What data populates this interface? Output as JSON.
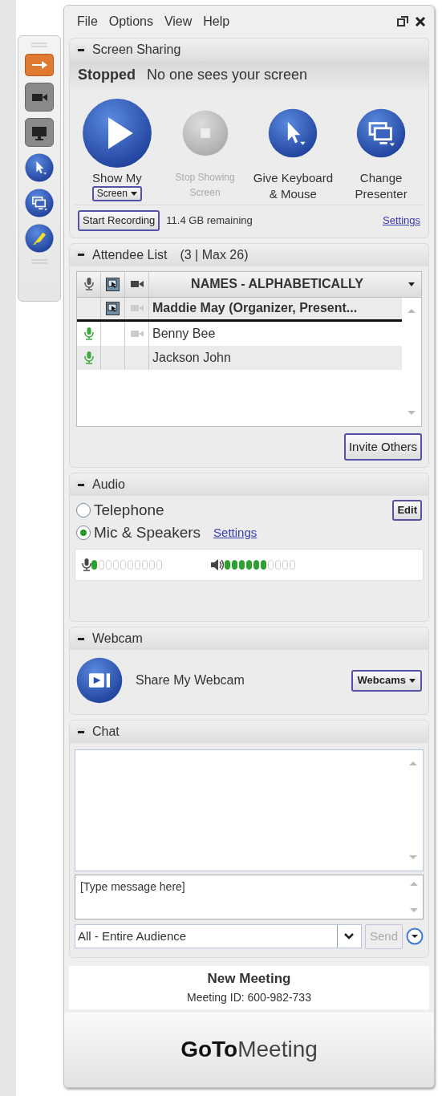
{
  "menu": [
    "File",
    "Options",
    "View",
    "Help"
  ],
  "toolbar": [
    {
      "kind": "panel",
      "selected": true
    },
    {
      "kind": "webcam",
      "selected": false
    },
    {
      "kind": "screen",
      "selected": false
    },
    {
      "kind": "pointer",
      "selected": false
    },
    {
      "kind": "presenter",
      "selected": false
    },
    {
      "kind": "draw",
      "selected": false
    }
  ],
  "screen_sharing": {
    "title": "Screen Sharing",
    "status": "Stopped",
    "status_text": "No one sees your screen",
    "actions": [
      {
        "kind": "play",
        "label": "Show My",
        "dropdown": "Screen",
        "disabled": false
      },
      {
        "kind": "stop",
        "label": "Stop Showing Screen",
        "disabled": true
      },
      {
        "kind": "pointer",
        "label": "Give Keyboard & Mouse",
        "disabled": false
      },
      {
        "kind": "presenter",
        "label": "Change Presenter",
        "disabled": false
      }
    ],
    "record_button": "Start Recording",
    "remaining": "11.4 GB remaining",
    "settings": "Settings"
  },
  "attendees": {
    "title": "Attendee List",
    "count": "(3 | Max 26)",
    "sort": "NAMES - ALPHABETICALLY",
    "rows": [
      {
        "name": "Maddie May (Organizer, Present...",
        "organizer": true,
        "mic": false,
        "presenter": true,
        "webcam": true
      },
      {
        "name": "Benny Bee",
        "organizer": false,
        "mic": true,
        "presenter": false,
        "webcam": true
      },
      {
        "name": "Jackson John",
        "organizer": false,
        "mic": true,
        "presenter": false,
        "webcam": false
      }
    ],
    "invite": "Invite Others"
  },
  "audio": {
    "title": "Audio",
    "options": [
      {
        "label": "Telephone",
        "selected": false
      },
      {
        "label": "Mic & Speakers",
        "selected": true
      }
    ],
    "edit": "Edit",
    "settings": "Settings",
    "mic": {
      "level": 0.1
    },
    "speaker": {
      "level": 0.6
    }
  },
  "webcam": {
    "title": "Webcam",
    "share": "Share My Webcam",
    "dropdown": "Webcams"
  },
  "chat": {
    "title": "Chat",
    "placeholder": "[Type message here]",
    "recipient": "All - Entire Audience",
    "send": "Send",
    "send_disabled": true
  },
  "meeting": {
    "title": "New Meeting",
    "id": "Meeting ID: 600-982-733"
  },
  "logo": "**GoTo**Meeting"
}
